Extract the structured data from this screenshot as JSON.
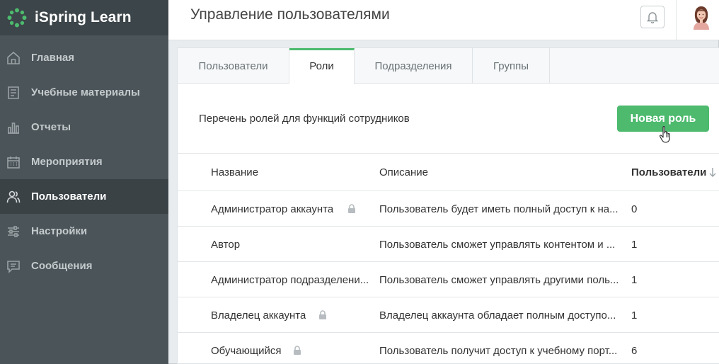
{
  "brand": {
    "name": "iSpring Learn",
    "accent": "#4dba6e"
  },
  "sidebar": {
    "items": [
      {
        "label": "Главная",
        "icon": "home-icon"
      },
      {
        "label": "Учебные материалы",
        "icon": "materials-icon"
      },
      {
        "label": "Отчеты",
        "icon": "reports-icon"
      },
      {
        "label": "Мероприятия",
        "icon": "calendar-icon"
      },
      {
        "label": "Пользователи",
        "icon": "users-icon",
        "active": true
      },
      {
        "label": "Настройки",
        "icon": "settings-icon"
      },
      {
        "label": "Сообщения",
        "icon": "messages-icon"
      }
    ]
  },
  "header": {
    "title": "Управление пользователями"
  },
  "tabs": [
    {
      "label": "Пользователи"
    },
    {
      "label": "Роли",
      "active": true
    },
    {
      "label": "Подразделения"
    },
    {
      "label": "Группы"
    }
  ],
  "toolbar": {
    "description": "Перечень ролей для функций сотрудников",
    "new_role_label": "Новая роль"
  },
  "table": {
    "columns": {
      "name": "Название",
      "description": "Описание",
      "users": "Пользователи"
    },
    "rows": [
      {
        "name": "Администратор аккаунта",
        "locked": true,
        "description": "Пользователь будет иметь полный доступ к на...",
        "users": "0"
      },
      {
        "name": "Автор",
        "locked": false,
        "description": "Пользователь сможет управлять контентом и ...",
        "users": "1"
      },
      {
        "name": "Администратор подразделени...",
        "locked": false,
        "description": "Пользователь сможет управлять другими поль...",
        "users": "1"
      },
      {
        "name": "Владелец аккаунта",
        "locked": true,
        "description": "Владелец аккаунта обладает полным доступо...",
        "users": "1"
      },
      {
        "name": "Обучающийся",
        "locked": true,
        "description": "Пользователь получит доступ к учебному порт...",
        "users": "6"
      }
    ]
  }
}
